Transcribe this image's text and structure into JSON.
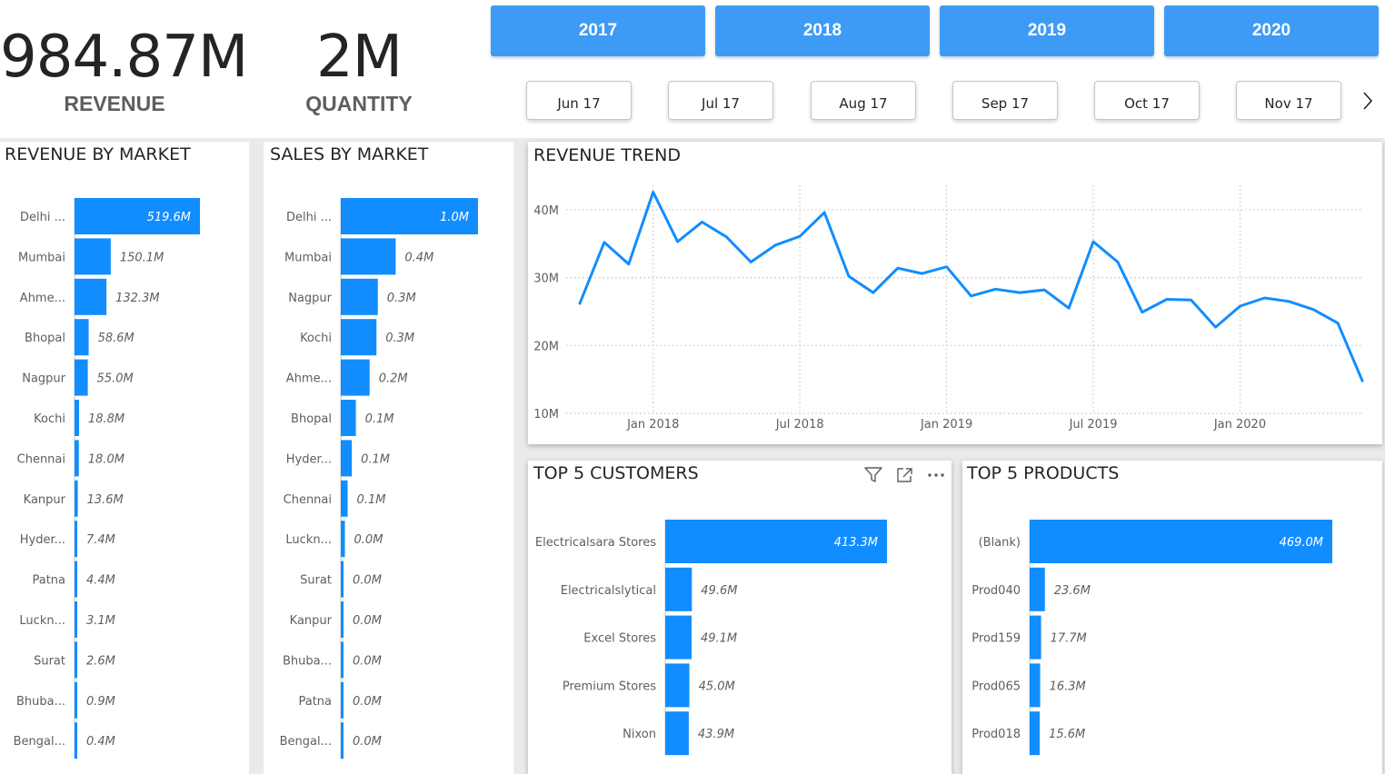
{
  "kpis": {
    "revenue": {
      "value": "984.87M",
      "label": "REVENUE"
    },
    "quantity": {
      "value": "2M",
      "label": "QUANTITY"
    }
  },
  "year_slicer": [
    "2017",
    "2018",
    "2019",
    "2020"
  ],
  "month_slicer": [
    "Jun 17",
    "Jul 17",
    "Aug 17",
    "Sep 17",
    "Oct 17",
    "Nov 17"
  ],
  "icons": {
    "next": "chevron-right-icon",
    "filter": "filter-icon",
    "focus": "focus-mode-icon",
    "more": "more-options-icon"
  },
  "colors": {
    "accent": "#118dff",
    "slicer": "#3d9bf5"
  },
  "visuals": {
    "revenue_by_market": "REVENUE BY MARKET",
    "sales_by_market": "SALES BY MARKET",
    "revenue_trend": "REVENUE TREND",
    "top_customers": "TOP 5 CUSTOMERS",
    "top_products": "TOP 5 PRODUCTS"
  },
  "chart_data": [
    {
      "id": "revenue_by_market",
      "type": "bar",
      "orientation": "horizontal",
      "title": "REVENUE BY MARKET",
      "categories": [
        "Delhi ...",
        "Mumbai",
        "Ahme...",
        "Bhopal",
        "Nagpur",
        "Kochi",
        "Chennai",
        "Kanpur",
        "Hyder...",
        "Patna",
        "Luckn...",
        "Surat",
        "Bhuba...",
        "Bengal..."
      ],
      "values": [
        519.6,
        150.1,
        132.3,
        58.6,
        55.0,
        18.8,
        18.0,
        13.6,
        7.4,
        4.4,
        3.1,
        2.6,
        0.9,
        0.4
      ],
      "labels": [
        "519.6M",
        "150.1M",
        "132.3M",
        "58.6M",
        "55.0M",
        "18.8M",
        "18.0M",
        "13.6M",
        "7.4M",
        "4.4M",
        "3.1M",
        "2.6M",
        "0.9M",
        "0.4M"
      ]
    },
    {
      "id": "sales_by_market",
      "type": "bar",
      "orientation": "horizontal",
      "title": "SALES BY MARKET",
      "categories": [
        "Delhi ...",
        "Mumbai",
        "Nagpur",
        "Kochi",
        "Ahme...",
        "Bhopal",
        "Hyder...",
        "Chennai",
        "Luckn...",
        "Surat",
        "Kanpur",
        "Bhuba...",
        "Patna",
        "Bengal..."
      ],
      "values": [
        1.0,
        0.4,
        0.27,
        0.26,
        0.21,
        0.11,
        0.08,
        0.05,
        0.03,
        0.02,
        0.02,
        0.01,
        0.01,
        0.01
      ],
      "labels": [
        "1.0M",
        "0.4M",
        "0.3M",
        "0.3M",
        "0.2M",
        "0.1M",
        "0.1M",
        "0.1M",
        "0.0M",
        "0.0M",
        "0.0M",
        "0.0M",
        "0.0M",
        "0.0M"
      ]
    },
    {
      "id": "revenue_trend",
      "type": "line",
      "title": "REVENUE TREND",
      "x_ticks": [
        "Jan 2018",
        "Jul 2018",
        "Jan 2019",
        "Jul 2019",
        "Jan 2020"
      ],
      "y_ticks": [
        "10M",
        "20M",
        "30M",
        "40M"
      ],
      "ylim": [
        10,
        42
      ],
      "series": [
        {
          "x": [
            "2017-10",
            "2017-11",
            "2017-12",
            "2018-01",
            "2018-02",
            "2018-03",
            "2018-04",
            "2018-05",
            "2018-06",
            "2018-07",
            "2018-08",
            "2018-09",
            "2018-10",
            "2018-11",
            "2018-12",
            "2019-01",
            "2019-02",
            "2019-03",
            "2019-04",
            "2019-05",
            "2019-06",
            "2019-07",
            "2019-08",
            "2019-09",
            "2019-10",
            "2019-11",
            "2019-12",
            "2020-01",
            "2020-02",
            "2020-03",
            "2020-04",
            "2020-05",
            "2020-06"
          ],
          "values": [
            26.2,
            35.2,
            32.0,
            42.6,
            35.3,
            38.2,
            36.0,
            32.3,
            34.8,
            36.1,
            39.6,
            30.2,
            27.8,
            31.4,
            30.6,
            31.6,
            27.3,
            28.3,
            27.8,
            28.2,
            25.5,
            35.3,
            32.3,
            24.9,
            26.8,
            26.7,
            22.7,
            25.8,
            27.0,
            26.5,
            25.3,
            23.3,
            14.8
          ]
        }
      ],
      "grid": true
    },
    {
      "id": "top_customers",
      "type": "bar",
      "orientation": "horizontal",
      "title": "TOP 5 CUSTOMERS",
      "categories": [
        "Electricalsara Stores",
        "Electricalslytical",
        "Excel Stores",
        "Premium Stores",
        "Nixon"
      ],
      "values": [
        413.3,
        49.6,
        49.1,
        45.0,
        43.9
      ],
      "labels": [
        "413.3M",
        "49.6M",
        "49.1M",
        "45.0M",
        "43.9M"
      ]
    },
    {
      "id": "top_products",
      "type": "bar",
      "orientation": "horizontal",
      "title": "TOP 5 PRODUCTS",
      "categories": [
        "(Blank)",
        "Prod040",
        "Prod159",
        "Prod065",
        "Prod018"
      ],
      "values": [
        469.0,
        23.6,
        17.7,
        16.3,
        15.6
      ],
      "labels": [
        "469.0M",
        "23.6M",
        "17.7M",
        "16.3M",
        "15.6M"
      ]
    }
  ]
}
